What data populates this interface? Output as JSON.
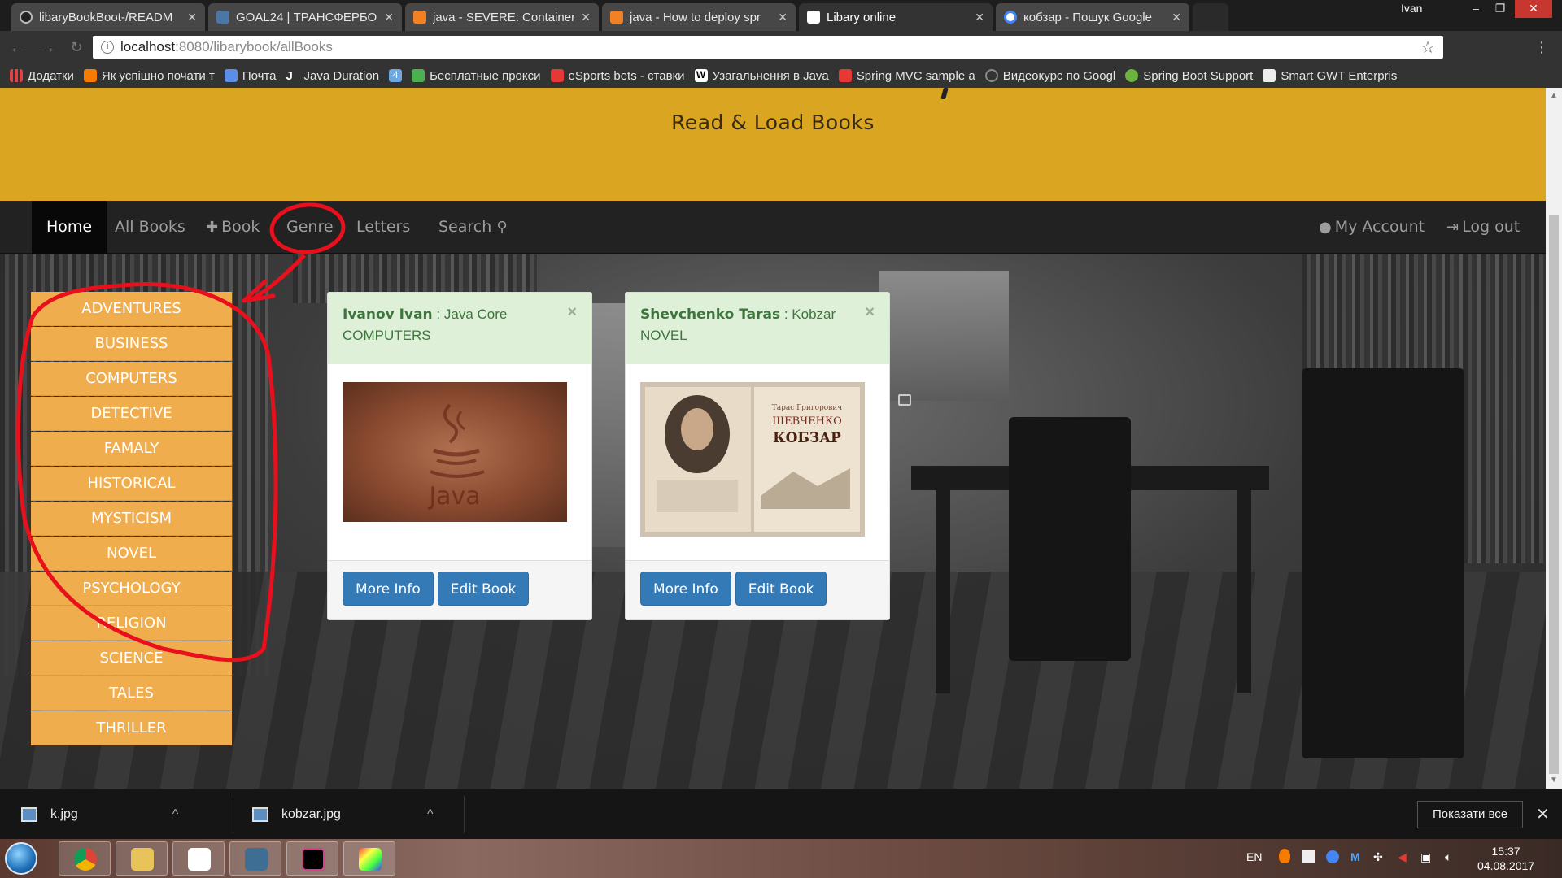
{
  "browser": {
    "tabs": [
      {
        "title": "libaryBookBoot-/READM",
        "color": "#333333"
      },
      {
        "title": "GOAL24 | ТРАНСФЕРБО",
        "color": "#4a76a8"
      },
      {
        "title": "java - SEVERE: Container",
        "color": "#f48024"
      },
      {
        "title": "java - How to deploy spr",
        "color": "#f48024"
      },
      {
        "title": "Libary online",
        "color": "#dddddd"
      },
      {
        "title": "кобзар - Пошук Google",
        "color": "#4285f4"
      }
    ],
    "window_user": "Ivan",
    "url_host": "localhost",
    "url_path": ":8080/libarybook/allBooks",
    "bookmarks": [
      {
        "label": "Додатки",
        "color": "#d44"
      },
      {
        "label": "Як успішно почати т",
        "color": "#f57c00"
      },
      {
        "label": "Почта",
        "color": "#5b8ee6"
      },
      {
        "label": "Java Duration",
        "color": "#ffffff"
      },
      {
        "label": "",
        "color": "#6fa8dc"
      },
      {
        "label": "Бесплатные прокси",
        "color": "#4caf50"
      },
      {
        "label": "eSports bets - ставки",
        "color": "#e53935"
      },
      {
        "label": "Узагальнення в Java",
        "color": "#ffffff"
      },
      {
        "label": "Spring MVC sample a",
        "color": "#e53935"
      },
      {
        "label": "Видеокурс по Googl",
        "color": "#888888"
      },
      {
        "label": "Spring Boot Support",
        "color": "#6db33f"
      },
      {
        "label": "Smart GWT Enterpris",
        "color": "#eeeeee"
      }
    ]
  },
  "site": {
    "title": "Read & Load Books",
    "nav": {
      "home": "Home",
      "all_books": "All Books",
      "book": "Book",
      "genre": "Genre",
      "letters": "Letters",
      "search": "Search",
      "my_account": "My Account",
      "log_out": "Log out"
    },
    "genres": [
      "ADVENTURES",
      "BUSINESS",
      "COMPUTERS",
      "DETECTIVE",
      "FAMALY",
      "HISTORICAL",
      "MYSTICISM",
      "NOVEL",
      "PSYCHOLOGY",
      "RELIGION",
      "SCIENCE",
      "TALES",
      "THRILLER"
    ],
    "books": [
      {
        "author": "Ivanov Ivan",
        "sep": ":",
        "title": "Java Core",
        "genre": "COMPUTERS",
        "cover_text": "Java",
        "more": "More Info",
        "edit": "Edit Book",
        "close": "×"
      },
      {
        "author": "Shevchenko Taras",
        "sep": ":",
        "title": "Kobzar",
        "genre": "NOVEL",
        "cover_text": "КОБЗАР",
        "cover_sub": "ШЕВЧЕНКО",
        "cover_top": "Тарас Григорович",
        "more": "More Info",
        "edit": "Edit Book",
        "close": "×"
      }
    ]
  },
  "downloads": {
    "items": [
      {
        "name": "k.jpg"
      },
      {
        "name": "kobzar.jpg"
      }
    ],
    "show_all": "Показати все"
  },
  "taskbar": {
    "lang": "EN",
    "time": "15:37",
    "date": "04.08.2017"
  },
  "colors": {
    "header": "#daa520",
    "genre": "#f0ad4e",
    "primary": "#337ab7",
    "annotation": "#e8101c"
  }
}
